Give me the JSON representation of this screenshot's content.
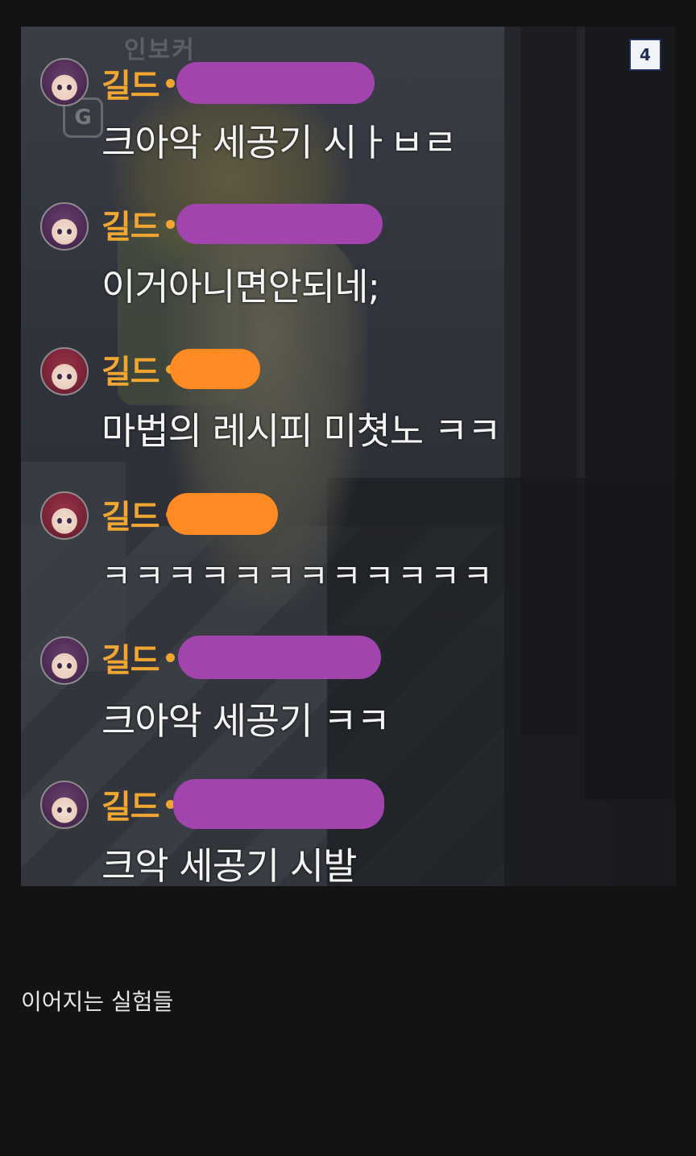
{
  "post": {
    "image_page_number": "4",
    "caption": "이어지는 실험들"
  },
  "scene_text": {
    "sign": "인보커",
    "badge_letter": "G"
  },
  "chat": {
    "messages": [
      {
        "label": "길드",
        "redaction_color": "purple",
        "avatar": "purple",
        "text": "크아악 세공기 시ㅏㅂㄹ"
      },
      {
        "label": "길드",
        "redaction_color": "purple",
        "avatar": "purple",
        "text": "이거아니면안되네;"
      },
      {
        "label": "길드",
        "redaction_color": "orange",
        "avatar": "red",
        "text": "마법의 레시피 미쳣노 ㅋㅋ"
      },
      {
        "label": "길드",
        "redaction_color": "orange",
        "avatar": "red",
        "text": "ㅋㅋㅋㅋㅋㅋㅋㅋㅋㅋㅋㅋ"
      },
      {
        "label": "길드",
        "redaction_color": "purple",
        "avatar": "purple",
        "text": "크아악 세공기 ㅋㅋ"
      },
      {
        "label": "길드",
        "redaction_color": "purple",
        "avatar": "purple",
        "text": "크악 세공기 시발"
      }
    ]
  },
  "colors": {
    "guild_label": "#f1a632",
    "redact_purple": "#a244ad",
    "redact_orange": "#fd8a22",
    "page_background": "#131313"
  }
}
